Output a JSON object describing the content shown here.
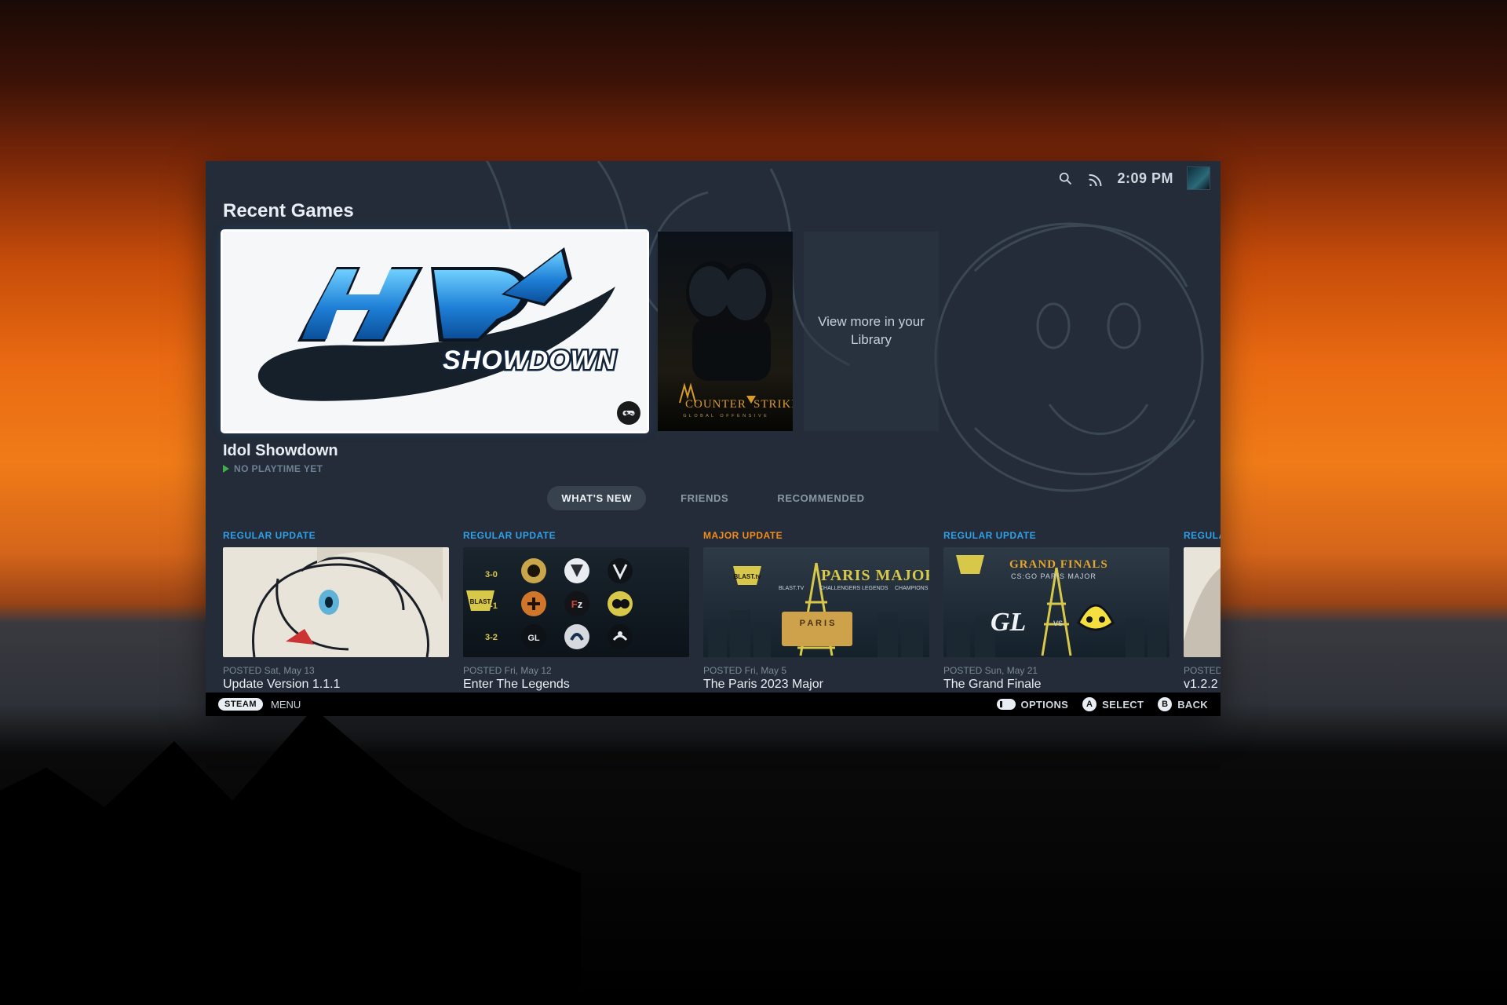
{
  "header": {
    "time": "2:09 PM"
  },
  "section_title": "Recent Games",
  "hero": {
    "selected_title": "Idol Showdown",
    "selected_subtitle": "NO PLAYTIME YET",
    "library_more": "View more in your Library",
    "game2_caption_top": "COUNTER",
    "game2_caption_bottom": "STRIKE"
  },
  "tabs": [
    {
      "label": "WHAT'S NEW",
      "active": true
    },
    {
      "label": "FRIENDS",
      "active": false
    },
    {
      "label": "RECOMMENDED",
      "active": false
    }
  ],
  "updates": [
    {
      "tag": "REGULAR UPDATE",
      "tag_type": "regular",
      "posted": "POSTED Sat, May 13",
      "headline": "Update Version 1.1.1"
    },
    {
      "tag": "REGULAR UPDATE",
      "tag_type": "regular",
      "posted": "POSTED Fri, May 12",
      "headline": "Enter The Legends"
    },
    {
      "tag": "MAJOR UPDATE",
      "tag_type": "major",
      "posted": "POSTED Fri, May 5",
      "headline": "The Paris 2023 Major"
    },
    {
      "tag": "REGULAR UPDATE",
      "tag_type": "regular",
      "posted": "POSTED Sun, May 21",
      "headline": "The Grand Finale"
    },
    {
      "tag": "REGULAR UPDATE",
      "tag_type": "regular",
      "posted": "POSTED",
      "headline": "v1.2.2"
    }
  ],
  "footer": {
    "steam": "STEAM",
    "menu": "MENU",
    "options": "OPTIONS",
    "select": "SELECT",
    "back": "BACK",
    "btn_a": "A",
    "btn_b": "B"
  },
  "thumb_text": {
    "paris_major": "PARIS MAJOR",
    "grand_finals": "GRAND FINALS",
    "grand_finals_sub": "CS:GO PARIS MAJOR",
    "gl": "GL",
    "vs": "vs",
    "s30": "3-0",
    "s31": "3-1",
    "s32": "3-2"
  }
}
